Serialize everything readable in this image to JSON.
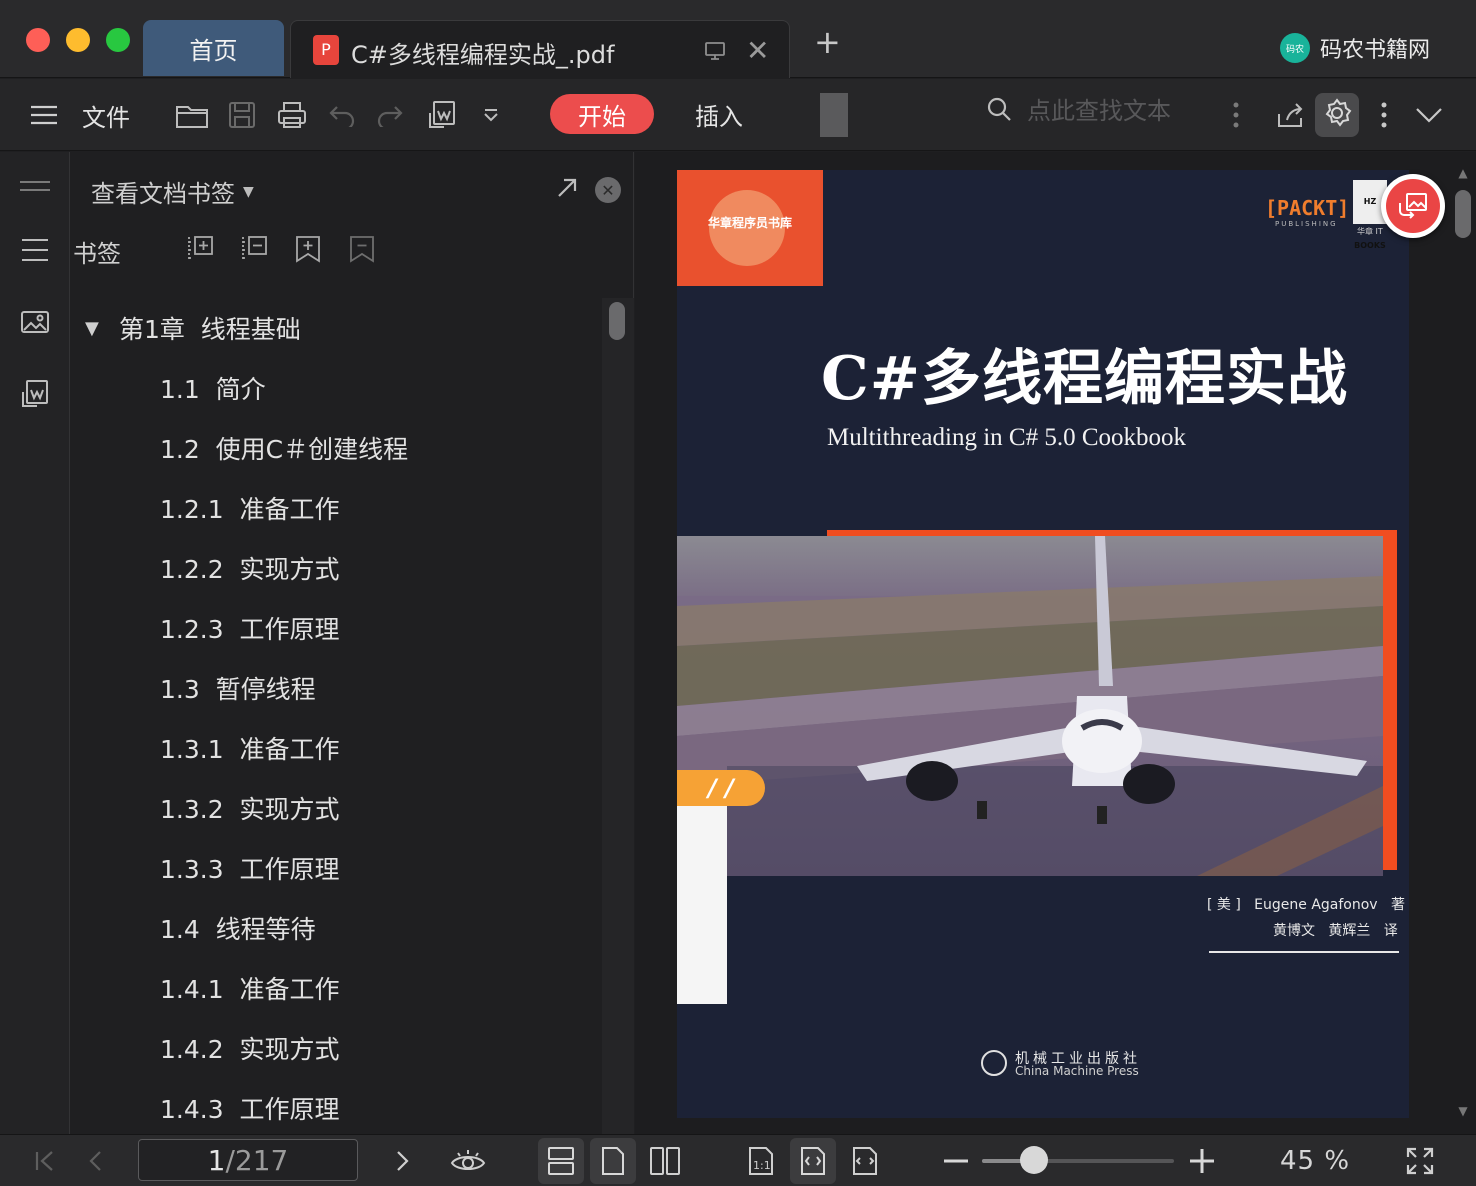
{
  "window": {
    "tabs": [
      {
        "label": "首页"
      },
      {
        "label": "C#多线程编程实战_.pdf"
      }
    ],
    "brand": {
      "logo_text": "码农",
      "name": "码农书籍网"
    }
  },
  "toolbar": {
    "file_label": "文件",
    "start_label": "开始",
    "insert_label": "插入",
    "search_placeholder": "点此查找文本"
  },
  "sidebar": {
    "panel_title": "查看文档书签",
    "bookmarks_label": "书签",
    "outline": [
      {
        "text": "第1章  线程基础",
        "level": 0,
        "expanded": true
      },
      {
        "text": "1.1  简介",
        "level": 1
      },
      {
        "text": "1.2  使用C＃创建线程",
        "level": 1
      },
      {
        "text": "1.2.1  准备工作",
        "level": 1
      },
      {
        "text": "1.2.2  实现方式",
        "level": 1
      },
      {
        "text": "1.2.3  工作原理",
        "level": 1
      },
      {
        "text": "1.3  暂停线程",
        "level": 1
      },
      {
        "text": "1.3.1  准备工作",
        "level": 1
      },
      {
        "text": "1.3.2  实现方式",
        "level": 1
      },
      {
        "text": "1.3.3  工作原理",
        "level": 1
      },
      {
        "text": "1.4  线程等待",
        "level": 1
      },
      {
        "text": "1.4.1  准备工作",
        "level": 1
      },
      {
        "text": "1.4.2  实现方式",
        "level": 1
      },
      {
        "text": "1.4.3  工作原理",
        "level": 1
      }
    ]
  },
  "document": {
    "cover": {
      "series_badge": "华章程序员书库",
      "publisher_logo": "[PACKT]",
      "publisher_logo_sub": "PUBLISHING",
      "imprint_logo": "HZ BOOKS",
      "imprint_sub": "华章 IT",
      "title": "C#多线程编程实战",
      "subtitle": "Multithreading in C# 5.0 Cookbook",
      "tab_mark": "/ /",
      "author_line": "[ 美 ]   Eugene Agafonov   著",
      "translator_line": "黄博文   黄辉兰   译",
      "press_cn": "机械工业出版社",
      "press_en": "China Machine Press"
    }
  },
  "statusbar": {
    "page_current": "1",
    "page_separator": "/",
    "page_total": "217",
    "zoom_percent": 45,
    "zoom_label": "45 %"
  },
  "colors": {
    "accent": "#ec4d4d",
    "home_tab": "#3f5a7a",
    "brand": "#19b39a"
  },
  "icons": [
    "hamburger-icon",
    "folder-icon",
    "save-icon",
    "print-icon",
    "undo-icon",
    "redo-icon",
    "export-icon",
    "dropdown-icon",
    "search-icon",
    "more-icon",
    "share-icon",
    "gear-icon",
    "chevron-down-icon"
  ]
}
